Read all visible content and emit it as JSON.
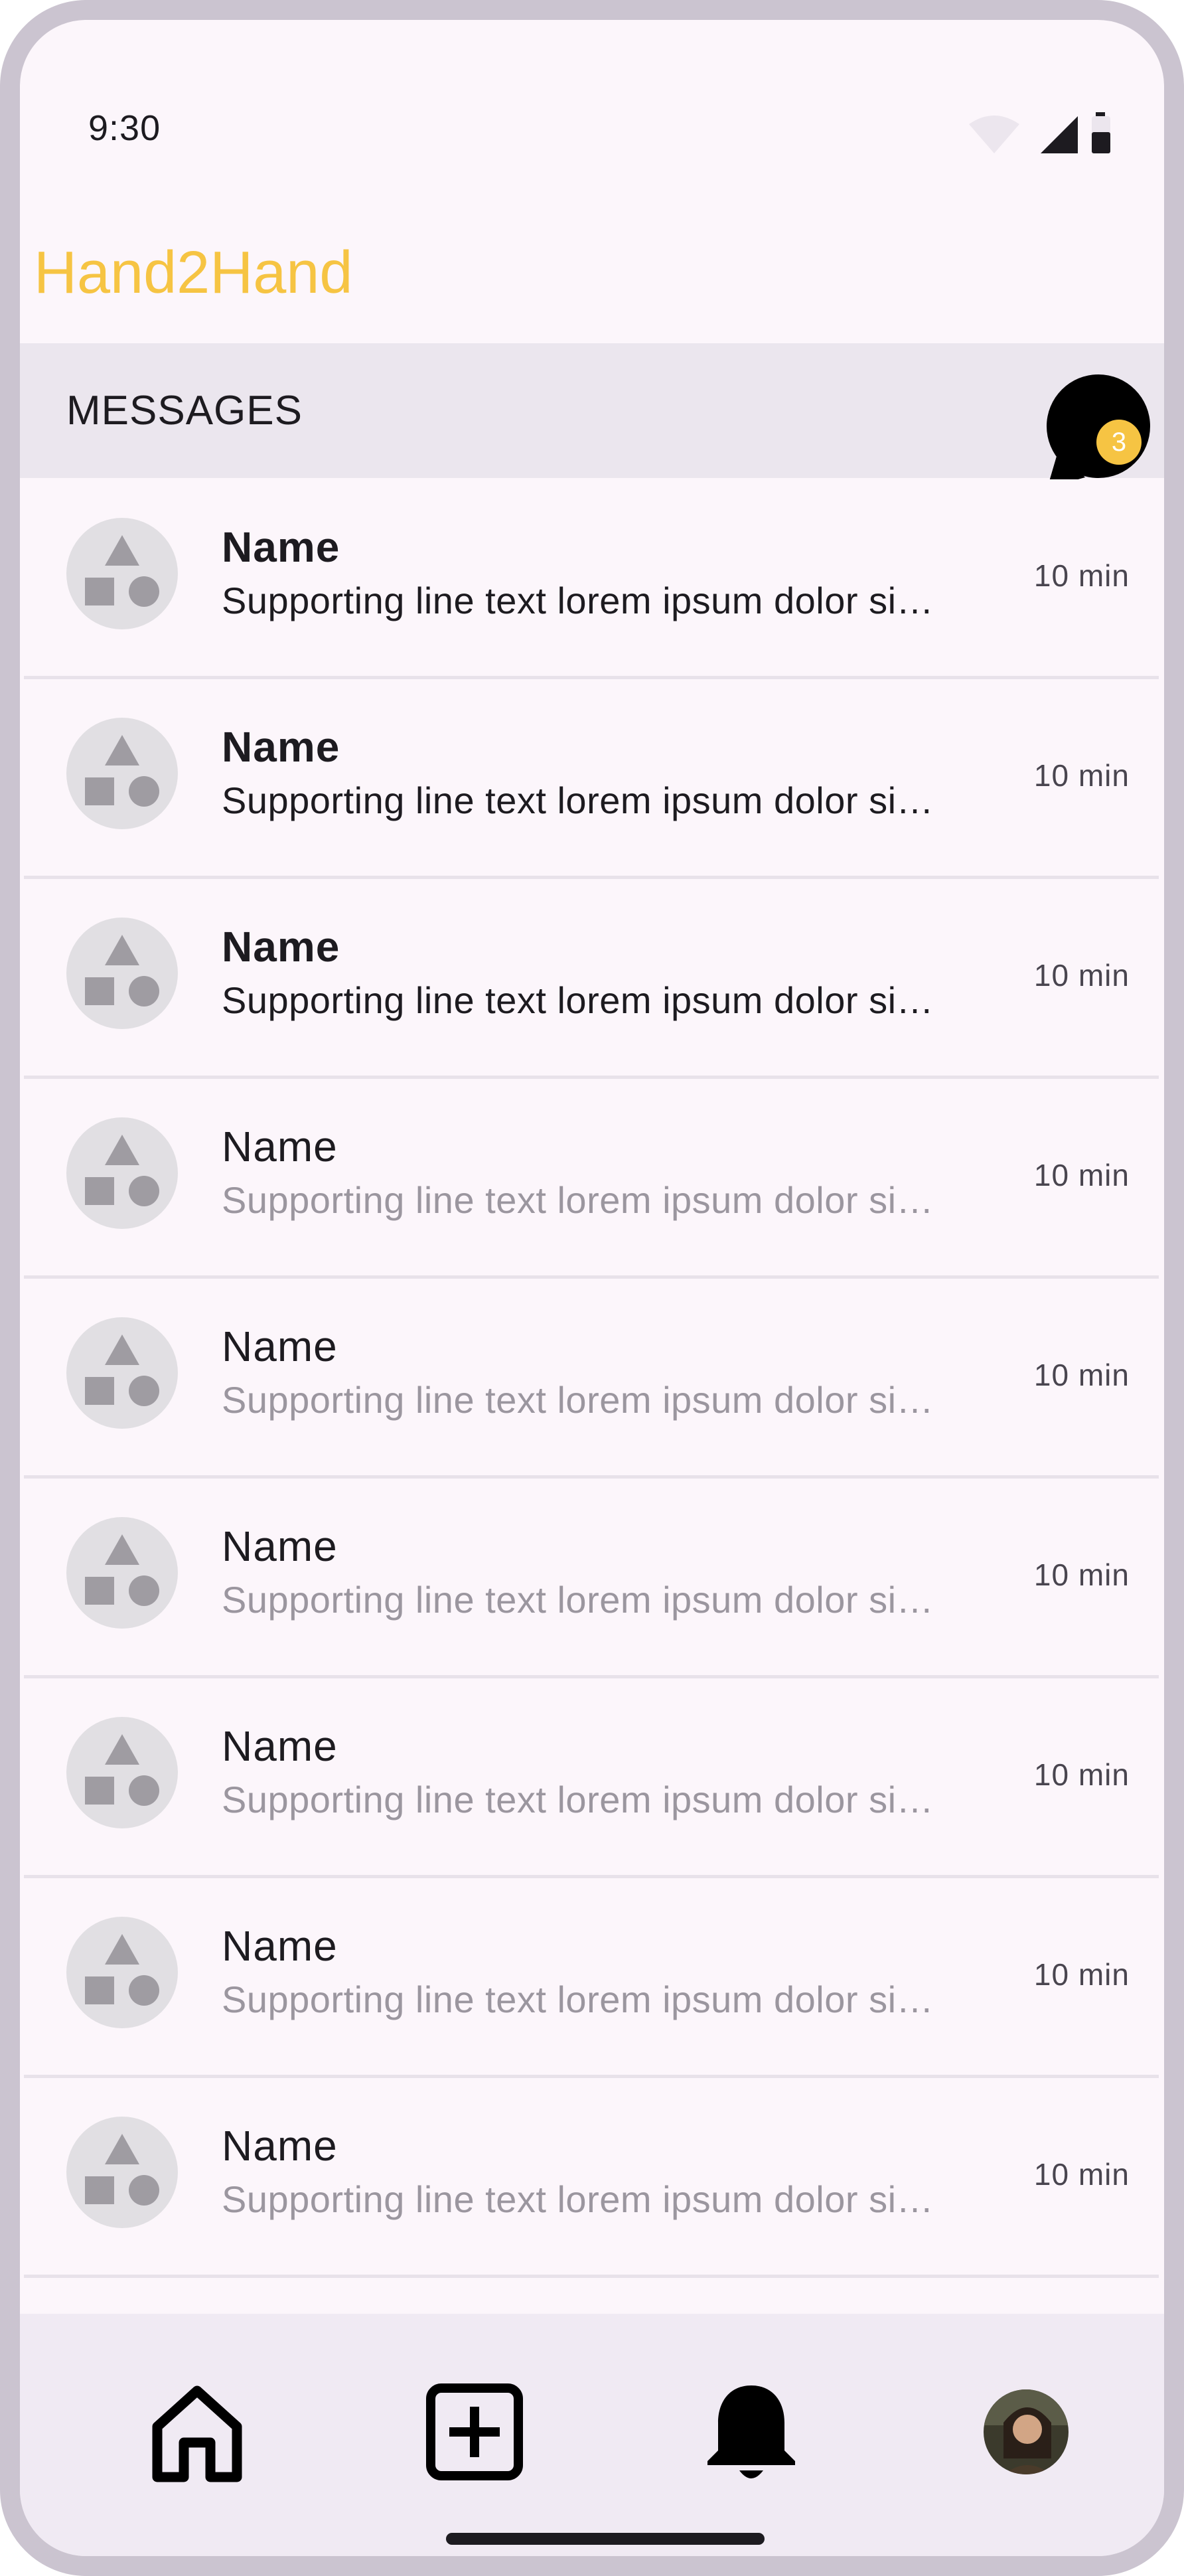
{
  "status_bar": {
    "time": "9:30"
  },
  "app": {
    "title": "Hand2Hand"
  },
  "section": {
    "title": "MESSAGES",
    "unread_count": "3"
  },
  "messages": [
    {
      "name": "Name",
      "preview": "Supporting line text lorem ipsum dolor si…",
      "time": "10 min",
      "unread": true
    },
    {
      "name": "Name",
      "preview": "Supporting line text lorem ipsum dolor si…",
      "time": "10 min",
      "unread": true
    },
    {
      "name": "Name",
      "preview": "Supporting line text lorem ipsum dolor si…",
      "time": "10 min",
      "unread": true
    },
    {
      "name": "Name",
      "preview": "Supporting line text lorem ipsum dolor si…",
      "time": "10 min",
      "unread": false
    },
    {
      "name": "Name",
      "preview": "Supporting line text lorem ipsum dolor si…",
      "time": "10 min",
      "unread": false
    },
    {
      "name": "Name",
      "preview": "Supporting line text lorem ipsum dolor si…",
      "time": "10 min",
      "unread": false
    },
    {
      "name": "Name",
      "preview": "Supporting line text lorem ipsum dolor si…",
      "time": "10 min",
      "unread": false
    },
    {
      "name": "Name",
      "preview": "Supporting line text lorem ipsum dolor si…",
      "time": "10 min",
      "unread": false
    },
    {
      "name": "Name",
      "preview": "Supporting line text lorem ipsum dolor si…",
      "time": "10 min",
      "unread": false
    }
  ],
  "nav": [
    {
      "icon": "home-icon"
    },
    {
      "icon": "add-box-icon"
    },
    {
      "icon": "bell-icon"
    },
    {
      "icon": "profile-avatar"
    }
  ],
  "colors": {
    "accent": "#f6c443",
    "background": "#fcf6fb",
    "header": "#ebe6ee",
    "nav": "#f0eaf3"
  }
}
